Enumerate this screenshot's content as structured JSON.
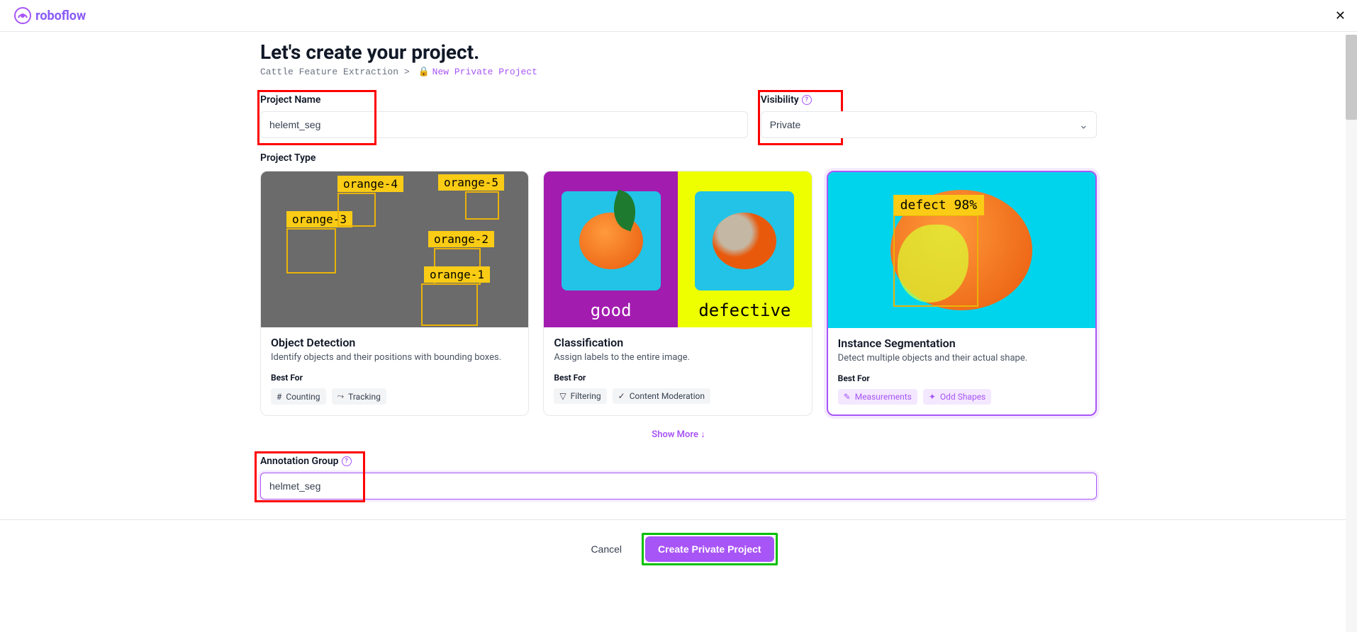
{
  "brand": "roboflow",
  "page_title": "Let's create your project.",
  "breadcrumb": {
    "workspace": "Cattle Feature Extraction",
    "separator": ">",
    "current": "New Private Project"
  },
  "project_name": {
    "label": "Project Name",
    "value": "helemt_seg"
  },
  "visibility": {
    "label": "Visibility",
    "value": "Private"
  },
  "project_type_label": "Project Type",
  "project_types": [
    {
      "title": "Object Detection",
      "description": "Identify objects and their positions with bounding boxes.",
      "best_for_label": "Best For",
      "chips": [
        "Counting",
        "Tracking"
      ],
      "selected": false,
      "preview_labels": [
        "orange-1",
        "orange-2",
        "orange-3",
        "orange-4",
        "orange-5"
      ]
    },
    {
      "title": "Classification",
      "description": "Assign labels to the entire image.",
      "best_for_label": "Best For",
      "chips": [
        "Filtering",
        "Content Moderation"
      ],
      "selected": false,
      "preview_labels": [
        "good",
        "defective"
      ]
    },
    {
      "title": "Instance Segmentation",
      "description": "Detect multiple objects and their actual shape.",
      "best_for_label": "Best For",
      "chips": [
        "Measurements",
        "Odd Shapes"
      ],
      "selected": true,
      "preview_labels": [
        "defect 98%"
      ]
    }
  ],
  "show_more": "Show More",
  "annotation_group": {
    "label": "Annotation Group",
    "value": "helmet_seg"
  },
  "footer": {
    "cancel": "Cancel",
    "submit": "Create Private Project"
  }
}
